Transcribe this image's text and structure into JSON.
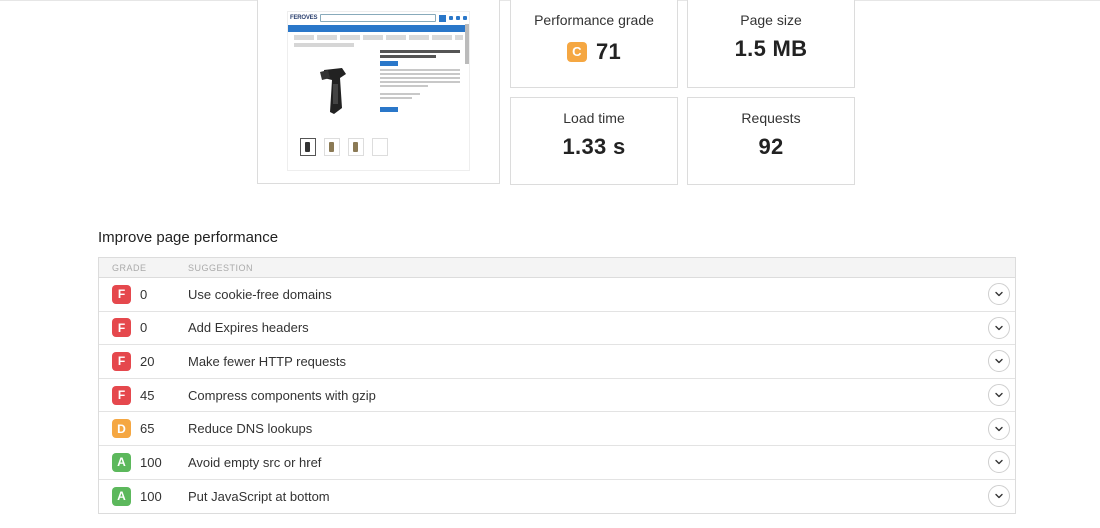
{
  "colors": {
    "grade_f": "#e5484d",
    "grade_d": "#f5a742",
    "grade_c": "#f5a742",
    "grade_a": "#5cb85c"
  },
  "screenshot": {
    "site_logo": "FEROVES"
  },
  "metrics": {
    "performance_grade": {
      "label": "Performance grade",
      "grade": "C",
      "value": "71"
    },
    "page_size": {
      "label": "Page size",
      "value": "1.5 MB"
    },
    "load_time": {
      "label": "Load time",
      "value": "1.33 s"
    },
    "requests": {
      "label": "Requests",
      "value": "92"
    }
  },
  "improve": {
    "title": "Improve page performance",
    "columns": {
      "grade": "GRADE",
      "suggestion": "SUGGESTION"
    },
    "rows": [
      {
        "grade": "F",
        "score": "0",
        "suggestion": "Use cookie-free domains",
        "expand_icon": "chevron-down-icon"
      },
      {
        "grade": "F",
        "score": "0",
        "suggestion": "Add Expires headers",
        "expand_icon": "chevron-down-icon"
      },
      {
        "grade": "F",
        "score": "20",
        "suggestion": "Make fewer HTTP requests",
        "expand_icon": "chevron-down-icon"
      },
      {
        "grade": "F",
        "score": "45",
        "suggestion": "Compress components with gzip",
        "expand_icon": "chevron-down-icon"
      },
      {
        "grade": "D",
        "score": "65",
        "suggestion": "Reduce DNS lookups",
        "expand_icon": "chevron-down-icon"
      },
      {
        "grade": "A",
        "score": "100",
        "suggestion": "Avoid empty src or href",
        "expand_icon": "chevron-down-icon"
      },
      {
        "grade": "A",
        "score": "100",
        "suggestion": "Put JavaScript at bottom",
        "expand_icon": "chevron-down-icon"
      }
    ]
  }
}
